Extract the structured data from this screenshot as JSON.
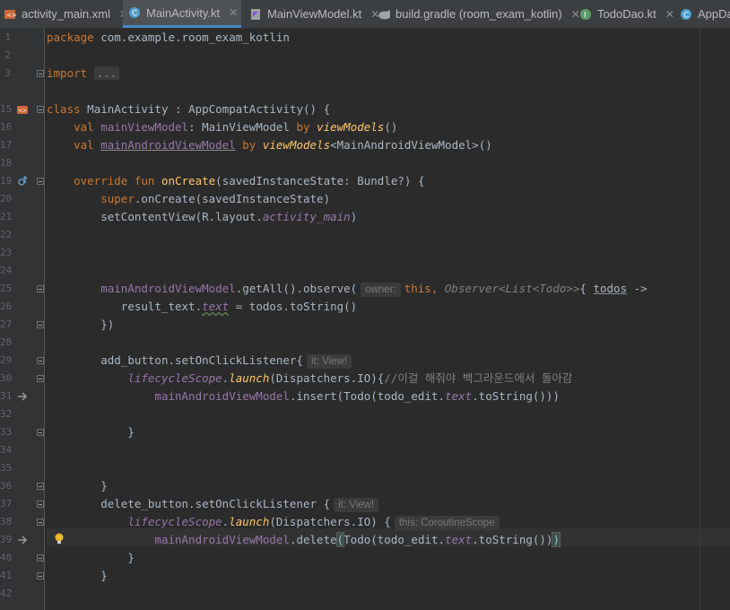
{
  "tabs": [
    {
      "label": "activity_main.xml",
      "icon": "xml-file-icon",
      "active": false
    },
    {
      "label": "MainActivity.kt",
      "icon": "kotlin-class-icon",
      "active": true
    },
    {
      "label": "MainViewModel.kt",
      "icon": "kotlin-file-icon",
      "active": false
    },
    {
      "label": "build.gradle (room_exam_kotlin)",
      "icon": "gradle-elephant-icon",
      "active": false
    },
    {
      "label": "TodoDao.kt",
      "icon": "kotlin-interface-icon",
      "active": false
    },
    {
      "label": "AppDa",
      "icon": "kotlin-class-icon",
      "active": false
    }
  ],
  "line_numbers": [
    "1",
    "2",
    "3",
    "15",
    "16",
    "17",
    "18",
    "19",
    "20",
    "21",
    "22",
    "23",
    "24",
    "25",
    "26",
    "27",
    "28",
    "29",
    "30",
    "31",
    "32",
    "33",
    "34",
    "35",
    "36",
    "37",
    "38",
    "39",
    "40",
    "41",
    "42"
  ],
  "code": {
    "package_kw": "package",
    "package_name": "com.example.room_exam_kotlin",
    "import_kw": "import",
    "import_fold": "...",
    "class_kw": "class",
    "class_name": "MainActivity",
    "class_sep": " : ",
    "super_call": "AppCompatActivity() {",
    "val_kw": "val",
    "vm1_name": "mainViewModel",
    "vm1_type": ": MainViewModel ",
    "by_kw": "by",
    "vm_delegate": "viewModels",
    "vm1_rest": "()",
    "vm2_name": "mainAndroidViewModel",
    "vm2_rest": "<MainAndroidViewModel>()",
    "override_kw": "override fun",
    "oncreate_name": "onCreate",
    "oncreate_params": "(savedInstanceState: Bundle?) {",
    "super_kw": "super",
    "super_oncreate": ".onCreate(savedInstanceState)",
    "set_content": "setContentView(R.layout.",
    "layout_ref": "activity_main",
    "close_paren": ")",
    "getall_call": ".getAll().observe(",
    "hint_owner": "owner:",
    "this_kw": "this,",
    "observer_type": "Observer<List<Todo>>",
    "todos_lambda_open": "{ ",
    "todos_param": "todos",
    "arrow": " ->",
    "result_text": "result_text.",
    "text_prop": "text",
    "assign_todos": " = todos.toString()",
    "close_lambda": "})",
    "add_listener": "add_button.setOnClickListener{",
    "hint_it": "it: View!",
    "lifecycle_scope": "lifecycleScope",
    "launch_fn": "launch",
    "dispatchers_io": "(Dispatchers.IO){",
    "comment_korean": "//이걸 해줘야 백그라운드에서 돌아감",
    "insert_call": ".insert(Todo(todo_edit.",
    "tostring_close": ".toString()))",
    "close_brace": "}",
    "delete_listener": "delete_button.setOnClickListener {",
    "dispatchers_io_space": "(Dispatchers.IO) {",
    "hint_this_scope": "this: CoroutineScope",
    "delete_call": ".delete",
    "delete_paren": "(",
    "delete_rest": "Todo(todo_edit.",
    "tostring_close2": ".toString())",
    "delete_final_paren": ")"
  },
  "colors": {
    "background": "#2b2b2b",
    "keyword": "#cc7832",
    "function": "#ffc66d",
    "property": "#9876aa",
    "comment": "#808080",
    "text": "#a9b7c6"
  }
}
